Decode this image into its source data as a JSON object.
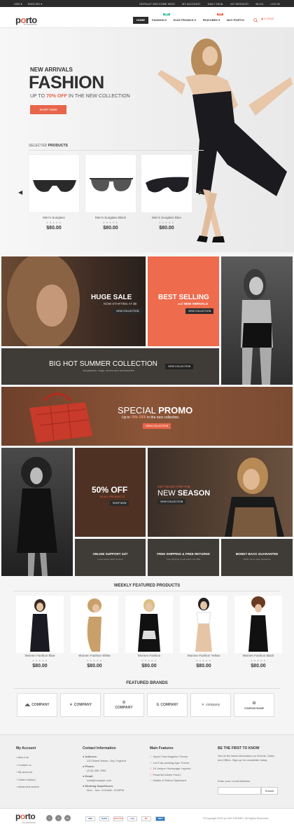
{
  "topbar": {
    "currency": "USD",
    "language": "ENGLISH",
    "links": [
      "DEFAULT WELCOME MSG!",
      "MY ACCOUNT",
      "DAILY DEAL",
      "MY WISHLIST",
      "BLOG",
      "LOG IN"
    ]
  },
  "logo": {
    "text_a": "p",
    "text_o": "o",
    "text_b": "rto",
    "sub": "eCommerce"
  },
  "nav": {
    "items": [
      {
        "label": "HOME"
      },
      {
        "label": "FASHION",
        "badge": "NEW"
      },
      {
        "label": "ELECTRONICS"
      },
      {
        "label": "FEATURES",
        "badge": "HOT"
      },
      {
        "label": "BUY PORTO!"
      }
    ],
    "cart": "0 ITEMS"
  },
  "hero": {
    "kicker": "NEW ARRIVALS",
    "title": "FASHION",
    "up_to": "UP TO",
    "pct": "70% OFF",
    "rest": "IN THE NEW COLLECTION",
    "button": "SHOP NOW",
    "selected_a": "SELECTED",
    "selected_b": "PRODUCTS"
  },
  "hero_products": [
    {
      "name": "Men's Sunglass",
      "price": "$80.00"
    },
    {
      "name": "Men's Sunglass Black",
      "price": "$80.00"
    },
    {
      "name": "Men's Sunglass Blue",
      "price": "$80.00"
    }
  ],
  "stars": "★★★★★",
  "promos": {
    "huge_sale": {
      "title": "HUGE SALE",
      "sub": "NOW STARTING AT $9",
      "btn": "VIEW COLLECTION"
    },
    "best_selling": {
      "title": "BEST SELLING",
      "sub_a": "and",
      "sub_b": "NEW ARRIVALS",
      "btn": "VIEW COLLECTION"
    },
    "summer": {
      "title": "BIG HOT SUMMER COLLECTION",
      "sub": "sunglasses, bags, shoes and accessories",
      "btn": "VIEW COLLECTION"
    },
    "special": {
      "title_a": "SPECIAL",
      "title_b": "PROMO",
      "sub_a": "Up to",
      "pct": "70% OFF",
      "sub_b": "in the new collection.",
      "btn": "VIEW COLLECTION"
    },
    "fifty": {
      "title": "50% OFF",
      "sub": "IN ALL PRODUCTS",
      "btn": "SHOP NOW"
    },
    "season": {
      "kicker": "GET READY FOR THE",
      "title_a": "NEW",
      "title_b": "SEASON",
      "btn": "VIEW COLLECTION"
    }
  },
  "services": [
    {
      "title": "ONLINE SUPPORT 24/7",
      "sub": "Lorem ipsum dolor sit amet"
    },
    {
      "title": "FREE SHIPPING & FREE RETURNS",
      "sub": "Free shipping on all orders over $99"
    },
    {
      "title": "MONEY BACK GUARANTEE",
      "sub": "100% money back guarantee"
    }
  ],
  "weekly": {
    "title": "WEEKLY FEATURED PRODUCTS",
    "items": [
      {
        "name": "Women Fashion Blue",
        "price": "$80.00"
      },
      {
        "name": "Women Fashion White",
        "price": "$80.00"
      },
      {
        "name": "Women Fashion",
        "price": "$80.00"
      },
      {
        "name": "Women Fashion Yellow",
        "price": "$80.00"
      },
      {
        "name": "Women Fashion Black",
        "price": "$80.00"
      }
    ]
  },
  "brands": {
    "title": "FEATURED BRANDS",
    "items": [
      "COMPANY",
      "COMPANY",
      "COMPANY",
      "COMPANY",
      "company",
      "COMPANYNAME"
    ]
  },
  "footer": {
    "account": {
      "title": "My Account",
      "links": [
        "About us",
        "Contact us",
        "My account",
        "Orders history",
        "Advanced search"
      ]
    },
    "contact": {
      "title": "Contact Information",
      "addr_l": "Address:",
      "addr": "123 Street Name, City, England",
      "phone_l": "Phone:",
      "phone": "(123) 456-7890",
      "email_l": "Email:",
      "email": "mail@example.com",
      "hours_l": "Working Days/Hours:",
      "hours": "Mon - Sun / 9:00AM - 8:00PM"
    },
    "features": {
      "title": "Main Features",
      "items": [
        "Super Fast Magento Theme",
        "1st Fully working Ajax Theme",
        "10 Unique Homepage Layouts",
        "Powerful Admin Panel",
        "Mobile & Retina Optimized"
      ]
    },
    "news": {
      "title": "BE THE FIRST TO KNOW",
      "text": "Get all the latest information on Events, Sales and Offers. Sign up for newsletter today.",
      "label": "Enter your e-mail Address",
      "submit": "Submit"
    }
  },
  "bottom": {
    "copyright": "©Copyright 2015 by SW-THEMES. All Rights Reserved.",
    "pay": [
      "VISA",
      "PayPal",
      "DISCOVER",
      "stripe",
      "MC",
      "AMEX"
    ]
  },
  "colors": {
    "accent": "#e8654a",
    "dark": "#2b2b2b",
    "teal": "#2ebf9d"
  }
}
